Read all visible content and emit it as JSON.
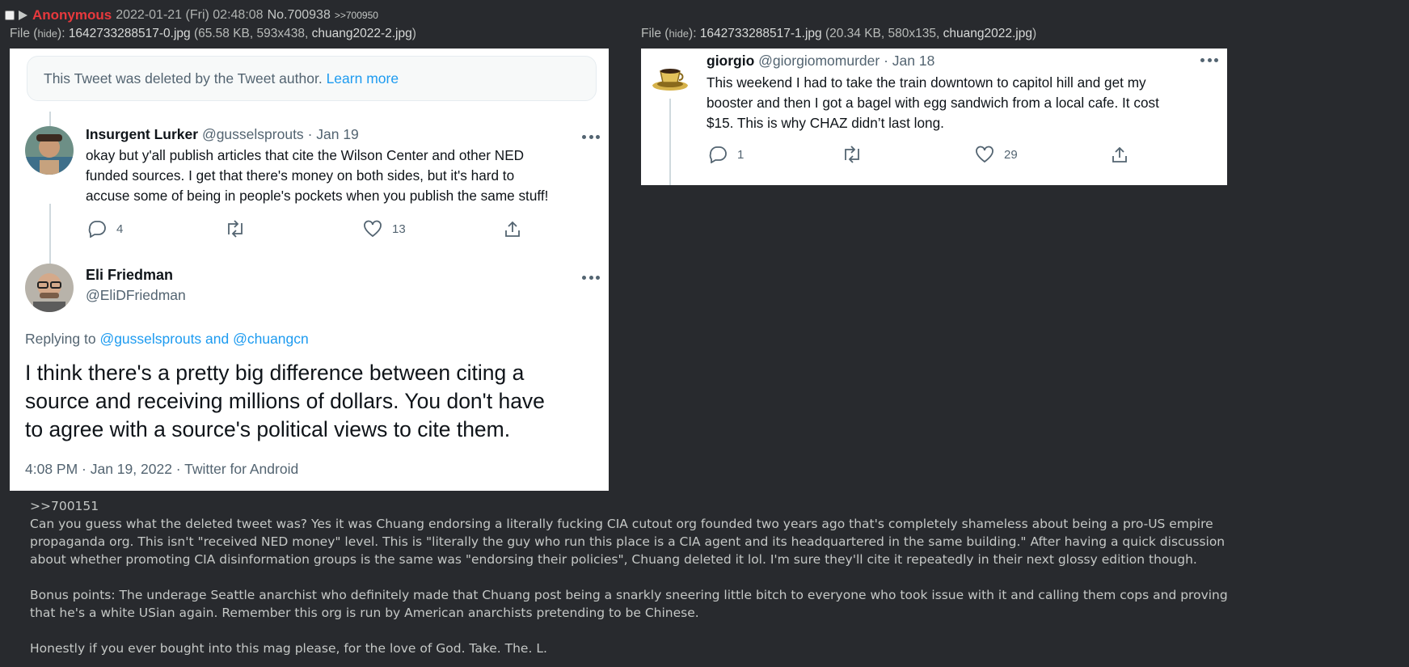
{
  "post": {
    "name": "Anonymous",
    "date": "2022-01-21 (Fri) 02:48:08",
    "number": "No.700938",
    "backlink": ">>700950"
  },
  "files": [
    {
      "label": "File",
      "hide": "hide",
      "filename": "1642733288517-0.jpg",
      "meta": "65.58 KB, 593x438",
      "original": "chuang2022-2.jpg"
    },
    {
      "label": "File",
      "hide": "hide",
      "filename": "1642733288517-1.jpg",
      "meta": "20.34 KB, 580x135",
      "original": "chuang2022.jpg"
    }
  ],
  "image1": {
    "deleted_notice": "This Tweet was deleted by the Tweet author.",
    "deleted_link": "Learn more",
    "reply": {
      "name": "Insurgent Lurker",
      "handle": "@gusselsprouts",
      "date": "· Jan 19",
      "lines": [
        "okay but y'all publish articles that cite the Wilson Center and other NED",
        "funded sources. I get that there's money on both sides, but it's hard to",
        "accuse some of being in people's pockets when you publish the same stuff!"
      ],
      "replies": "4",
      "likes": "13"
    },
    "main": {
      "name": "Eli Friedman",
      "handle": "@EliDFriedman",
      "replying_label": "Replying to",
      "replying_to": "@gusselsprouts and @chuangcn",
      "lines": [
        "I think there's a pretty big difference between citing a",
        "source and receiving millions of dollars. You don't have",
        "to agree with a source's political views to cite them."
      ],
      "timestamp": "4:08 PM · Jan 19, 2022 · Twitter for Android"
    }
  },
  "image2": {
    "name": "giorgio",
    "handle": "@giorgiomomurder",
    "date": "· Jan 18",
    "lines": [
      "This weekend I had to take the train downtown to capitol hill and get my",
      "booster and then I got a bagel with egg sandwich from a local cafe. It cost",
      "$15. This is why CHAZ didn’t last long."
    ],
    "replies": "1",
    "likes": "29"
  },
  "comment": {
    "quote": ">>700151",
    "p1": [
      "Can you guess what the deleted tweet was? Yes it was Chuang endorsing a literally fucking CIA cutout org founded two years ago that's completely shameless about being a pro-US empire",
      "propaganda org. This isn't \"received NED money\" level. This is \"literally the guy who run this place is a CIA agent and its headquartered in the same building.\" After having a quick discussion",
      "about whether promoting CIA disinformation groups is the same was \"endorsing their policies\", Chuang deleted it lol. I'm sure they'll cite it repeatedly in their next glossy edition though."
    ],
    "p2": [
      "Bonus points: The underage Seattle anarchist who definitely made that Chuang post being a snarkly sneering little bitch to everyone who took issue with it and calling them cops and proving",
      "that he's a white USian again. Remember this org is run by American anarchists pretending to be Chinese."
    ],
    "p3": "Honestly if you ever bought into this mag please, for the love of God. Take. The. L."
  }
}
